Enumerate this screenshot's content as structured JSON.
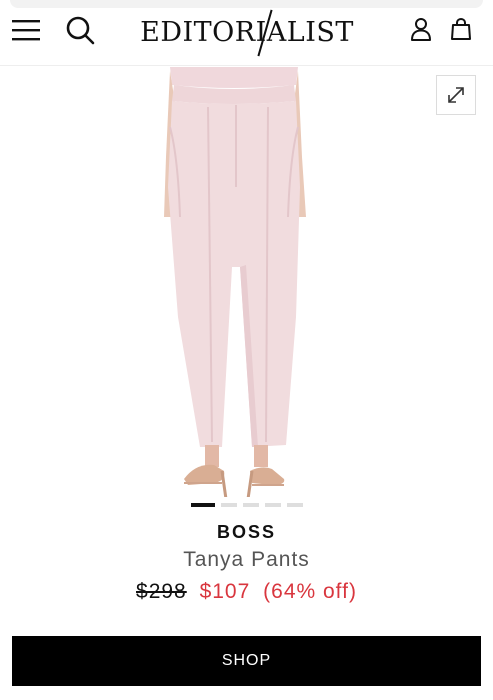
{
  "header": {
    "logo_text": "EDITORIALIST",
    "icons": {
      "menu": "hamburger-menu-icon",
      "search": "search-icon",
      "account": "user-account-icon",
      "bag": "shopping-bag-icon",
      "expand": "expand-arrows-icon"
    }
  },
  "gallery": {
    "total_images": 5,
    "active_index": 0,
    "image_subject": "light pink tailored trousers with nude strappy heels"
  },
  "product": {
    "brand": "BOSS",
    "name": "Tanya Pants",
    "original_price": "$298",
    "sale_price": "$107",
    "discount": "(64% off)"
  },
  "cta": {
    "shop_label": "SHOP"
  },
  "colors": {
    "sale": "#d9363e",
    "button_bg": "#000000",
    "pants": "#f1dcde"
  }
}
